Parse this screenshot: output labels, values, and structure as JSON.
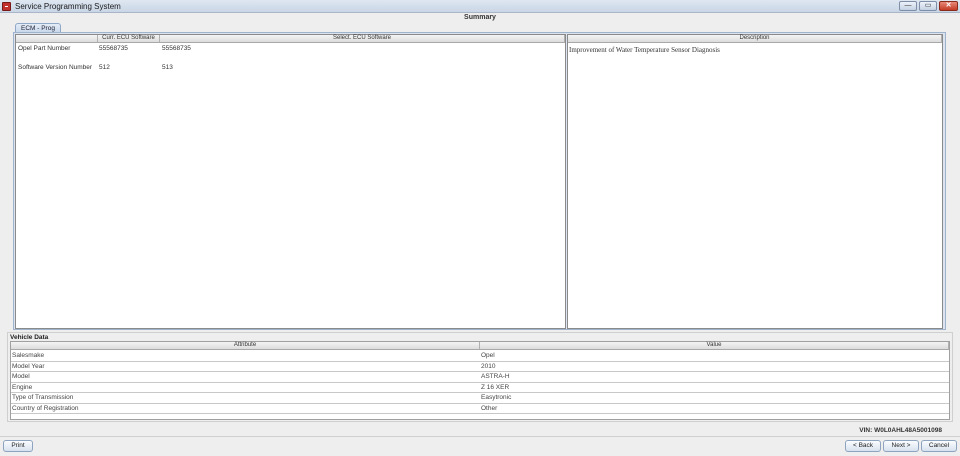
{
  "window": {
    "title": "Service Programming System",
    "min_glyph": "—",
    "max_glyph": "▭",
    "close_glyph": "✕"
  },
  "page": {
    "heading": "Summary"
  },
  "tabs": [
    {
      "label": "ECM - Prog"
    }
  ],
  "software_table": {
    "columns": [
      "",
      "Curr. ECU Software",
      "Select. ECU Software"
    ],
    "rows": [
      {
        "label": "Opel Part Number",
        "current": "55568735",
        "selected": "55568735"
      },
      {
        "label": "Software Version Number",
        "current": "512",
        "selected": "513"
      }
    ]
  },
  "description_table": {
    "column": "Description",
    "text": "Improvement of Water Temperature Sensor Diagnosis"
  },
  "vehicle_data": {
    "title": "Vehicle Data",
    "columns": [
      "Attribute",
      "Value"
    ],
    "rows": [
      {
        "attribute": "Salesmake",
        "value": "Opel"
      },
      {
        "attribute": "Model Year",
        "value": "2010"
      },
      {
        "attribute": "Model",
        "value": "ASTRA-H"
      },
      {
        "attribute": "Engine",
        "value": "Z 16 XER"
      },
      {
        "attribute": "Type of Transmission",
        "value": "Easytronic"
      },
      {
        "attribute": "Country of Registration",
        "value": "Other"
      }
    ]
  },
  "vin": "VIN: W0L0AHL48A5001098",
  "buttons": {
    "print": "Print",
    "back": "< Back",
    "next": "Next >",
    "cancel": "Cancel"
  }
}
